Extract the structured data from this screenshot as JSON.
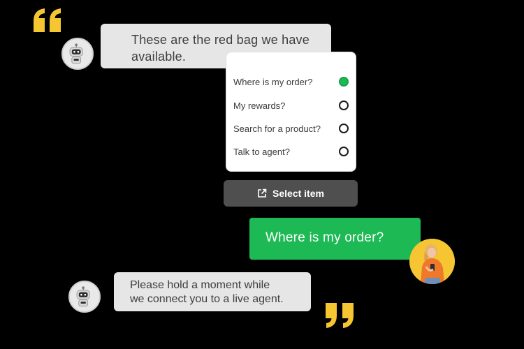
{
  "chat": {
    "bot_message_1": {
      "line_1": "These are the red bag we have",
      "line_2": "available."
    },
    "options": [
      {
        "label": "Where is my order?",
        "selected": true
      },
      {
        "label": "My rewards?",
        "selected": false
      },
      {
        "label": "Search for a product?",
        "selected": false
      },
      {
        "label": "Talk to agent?",
        "selected": false
      }
    ],
    "select_button": {
      "label": "Select item",
      "icon": "external-link-icon"
    },
    "user_message": "Where is my order?",
    "bot_message_2": {
      "line_1": "Please hold a moment while",
      "line_2": "we connect you to a live agent."
    }
  },
  "colors": {
    "accent_green": "#1db954",
    "quote_yellow": "#f6c532",
    "bubble_gray": "#e6e6e6",
    "button_gray": "#4f4f4f"
  },
  "icons": [
    "open-quote-icon",
    "close-quote-icon",
    "robot-icon",
    "external-link-icon",
    "user-avatar"
  ]
}
